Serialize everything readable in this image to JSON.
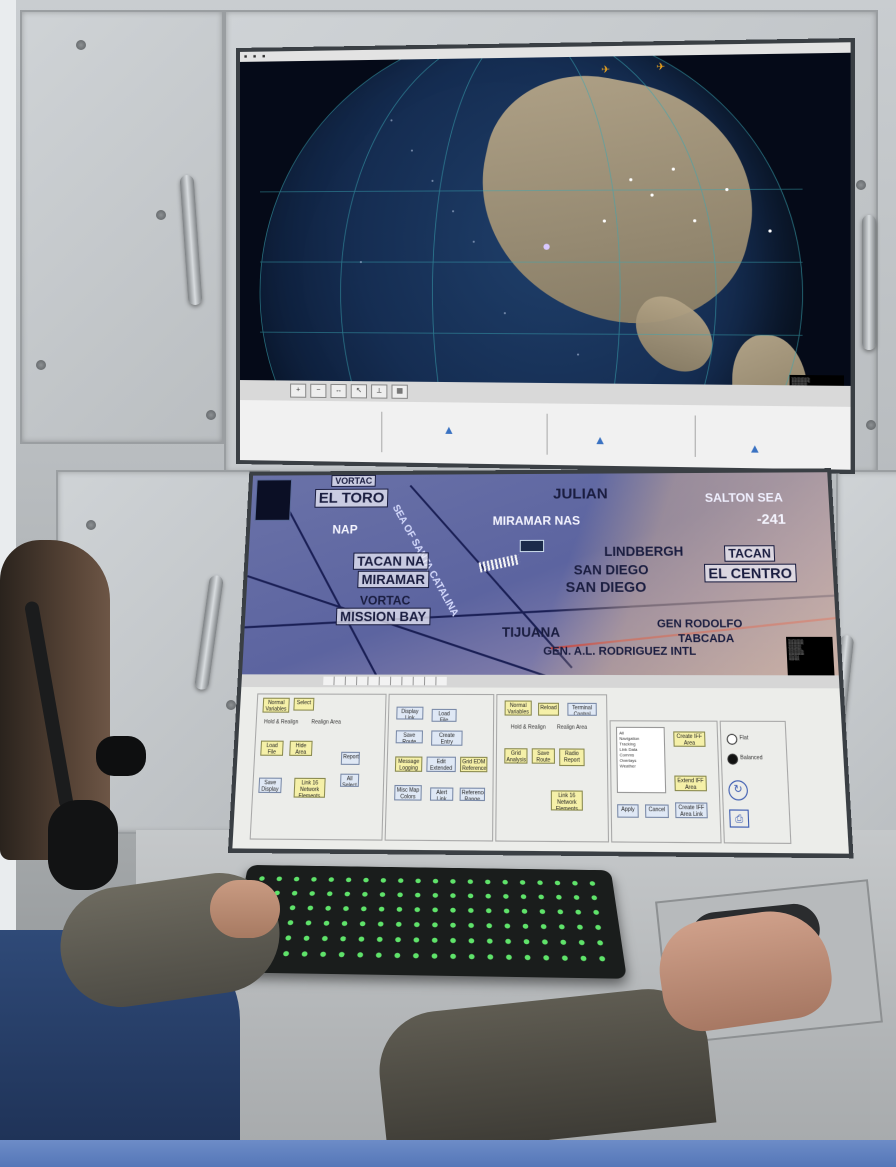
{
  "map_labels": {
    "el_toro": "EL TORO",
    "julian": "JULIAN",
    "salton_sea": "SALTON SEA",
    "miramar_nas": "MIRAMAR NAS",
    "minus_241": "-241",
    "tacan_na": "TACAN NA",
    "miramar": "MIRAMAR",
    "san_diego_1": "SAN DIEGO",
    "san_diego_2": "SAN DIEGO",
    "tacan": "TACAN",
    "el_centro": "EL CENTRO",
    "vortac_top": "VORTAC",
    "vortac": "VORTAC",
    "mission_bay": "MISSION BAY",
    "tijuana": "TIJUANA",
    "gen_rodolfo": "GEN RODOLFO",
    "tabcada": "TABCADA",
    "gen_al_rodriguez": "GEN. A.L. RODRIGUEZ INTL",
    "nap": "NAP",
    "lindbergh": "LINDBERGH",
    "sea_of_santa_catalina": "SEA OF SANTA CATALINA"
  },
  "control_panel": {
    "buttons": [
      "Normal Variables",
      "Select",
      "Hold & Realign",
      "Realign Area",
      "Load File",
      "Hide Area",
      "Save Display",
      "Reports",
      "All Select",
      "Link 16 Network Elements",
      "Display Link",
      "Load File",
      "Save Route",
      "Create Entry Config File",
      "Message Logging",
      "Edit Extended Display",
      "Grid EDM Reference",
      "Misc Map Colors",
      "Alert Link",
      "Reference Range",
      "Normal Variables",
      "Reload",
      "Terminal Control",
      "Hold & Realign",
      "Realign Area",
      "Grid Analysis",
      "Save Route",
      "Radio Report",
      "Link 16 Network Elements",
      "Apply",
      "Cancel",
      "Create IFF Area",
      "Extend IFF Area",
      "Create IFF Area Link"
    ],
    "list_items": [
      "All",
      "Navigation",
      "Tracking",
      "Link Data",
      "Comms",
      "Overlays",
      "Weather"
    ],
    "radio_flat": "Flat",
    "radio_balanced": "Balanced"
  },
  "colors": {
    "ocean": "#152d52",
    "land": "#b8a88a",
    "chart_bg": "#5c64a0",
    "keyboard_backlight": "#5fe36a",
    "accent_bar": "#5577b8"
  }
}
